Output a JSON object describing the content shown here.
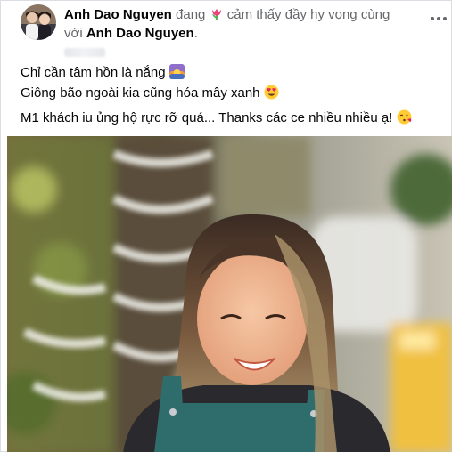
{
  "post": {
    "author_name": "Anh Dao Nguyen",
    "activity_prefix": "đang",
    "feeling_icon": "tulip-emoji",
    "feeling_text": "cảm thấy đầy hy vọng cùng",
    "tagged_prefix": "với",
    "tagged_name": "Anh Dao Nguyen",
    "tagged_suffix": ".",
    "lines": [
      "Chỉ cần tâm hồn là nắng",
      "Giông bão ngoài kia cũng hóa mây xanh",
      "M1 khách iu ủng hộ rực rỡ quá... Thanks các ce nhiều nhiều ạ!"
    ],
    "line_emojis": [
      "sunrise-emoji",
      "heart-eyes-emoji",
      "face-blowing-kiss-emoji"
    ],
    "more_icon": "more-horizontal-icon",
    "colors": {
      "name": "#050505",
      "muted": "#65676b",
      "border": "#dadde1"
    }
  }
}
